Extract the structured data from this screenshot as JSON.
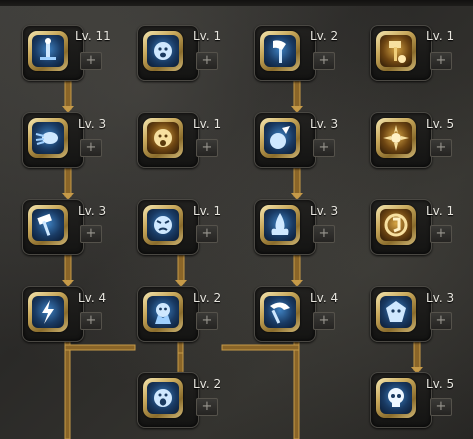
{
  "header": {
    "clipped_text": "··· ·· ·· ··· ·· ·· ·····"
  },
  "level_prefix": "Lv.",
  "skills": [
    {
      "id": "skill-1",
      "level": "Lv. 11",
      "plus": "+",
      "icon": "blue-sword-pillar-icon"
    },
    {
      "id": "skill-2",
      "level": "Lv. 1",
      "plus": "+",
      "icon": "blue-roaring-face-icon"
    },
    {
      "id": "skill-3",
      "level": "Lv. 2",
      "plus": "+",
      "icon": "blue-axe-icon"
    },
    {
      "id": "skill-4",
      "level": "Lv. 1",
      "plus": "+",
      "icon": "gold-hammer-strike-icon"
    },
    {
      "id": "skill-5",
      "level": "Lv. 3",
      "plus": "+",
      "icon": "blue-dash-icon"
    },
    {
      "id": "skill-6",
      "level": "Lv. 1",
      "plus": "+",
      "icon": "gold-war-cry-icon"
    },
    {
      "id": "skill-7",
      "level": "Lv. 3",
      "plus": "+",
      "icon": "blue-smash-orb-icon"
    },
    {
      "id": "skill-8",
      "level": "Lv. 5",
      "plus": "+",
      "icon": "gold-burst-icon"
    },
    {
      "id": "skill-9",
      "level": "Lv. 3",
      "plus": "+",
      "icon": "blue-hammer-swing-icon"
    },
    {
      "id": "skill-10",
      "level": "Lv. 1",
      "plus": "+",
      "icon": "blue-angry-face-icon"
    },
    {
      "id": "skill-11",
      "level": "Lv. 3",
      "plus": "+",
      "icon": "blue-flame-icon"
    },
    {
      "id": "skill-12",
      "level": "Lv. 1",
      "plus": "+",
      "icon": "gold-shield-rune-icon"
    },
    {
      "id": "skill-13",
      "level": "Lv. 4",
      "plus": "+",
      "icon": "blue-lightning-axe-icon"
    },
    {
      "id": "skill-14",
      "level": "Lv. 2",
      "plus": "+",
      "icon": "blue-fury-face-icon"
    },
    {
      "id": "skill-15",
      "level": "Lv. 4",
      "plus": "+",
      "icon": "blue-cleave-icon"
    },
    {
      "id": "skill-16",
      "level": "Lv. 3",
      "plus": "+",
      "icon": "blue-spirit-mask-icon"
    },
    {
      "id": "skill-17",
      "level": "Lv. 2",
      "plus": "+",
      "icon": "blue-screaming-face-icon"
    },
    {
      "id": "skill-18",
      "level": "Lv. 5",
      "plus": "+",
      "icon": "blue-skull-icon"
    }
  ],
  "colors": {
    "line_gold": "#a8782c",
    "frame_gold": "#c9a95c",
    "icon_blue": "#3d7fbf"
  }
}
